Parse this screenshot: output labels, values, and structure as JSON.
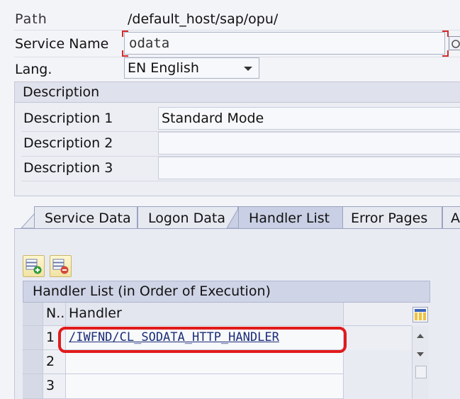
{
  "header": {
    "path_label": "Path",
    "path_value": "/default_host/sap/opu/",
    "service_label": "Service Name",
    "service_value": "odata",
    "lang_label": "Lang.",
    "lang_value": "EN English"
  },
  "description": {
    "title": "Description",
    "rows": [
      {
        "label": "Description 1",
        "value": "Standard Mode"
      },
      {
        "label": "Description 2",
        "value": ""
      },
      {
        "label": "Description 3",
        "value": ""
      }
    ]
  },
  "tabs": [
    {
      "label": "Service Data",
      "active": false
    },
    {
      "label": "Logon Data",
      "active": false
    },
    {
      "label": "Handler List",
      "active": true
    },
    {
      "label": "Error Pages",
      "active": false
    },
    {
      "label": "A",
      "active": false
    }
  ],
  "handler_table": {
    "title": "Handler List (in Order of Execution)",
    "col_num": "N..",
    "col_handler": "Handler",
    "rows": [
      {
        "num": "1",
        "handler": "/IWFND/CL_SODATA_HTTP_HANDLER"
      },
      {
        "num": "2",
        "handler": ""
      },
      {
        "num": "3",
        "handler": ""
      }
    ]
  },
  "icons": {
    "insert_row": "insert-row-icon",
    "delete_row": "delete-row-icon",
    "layout": "column-layout-icon",
    "search_help": "search-help-icon"
  },
  "colors": {
    "highlight": "#e11b1b",
    "required_marker": "#d42a2a",
    "link": "#1b2d78"
  }
}
